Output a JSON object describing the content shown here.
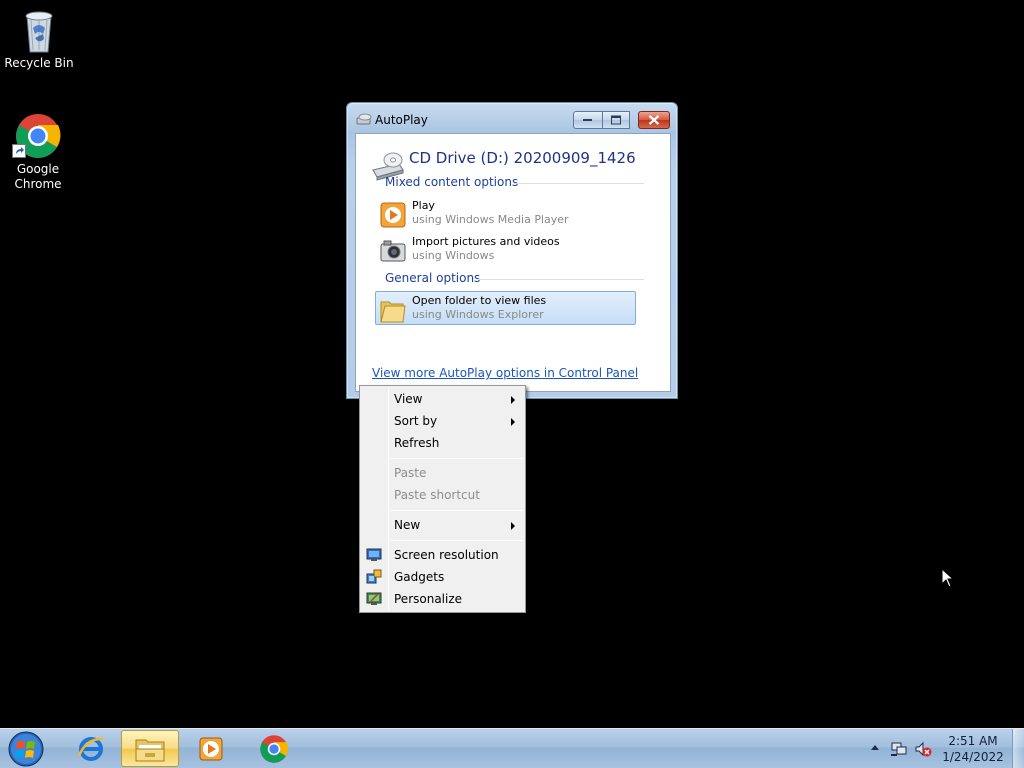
{
  "desktop": {
    "icons": [
      {
        "label": "Recycle Bin",
        "icon": "recycle-bin-icon"
      },
      {
        "label": "Google Chrome",
        "icon": "chrome-icon"
      }
    ]
  },
  "autoplay": {
    "title": "AutoPlay",
    "drive_title": "CD Drive (D:) 20200909_1426",
    "mixed_header": "Mixed content options",
    "options": [
      {
        "main": "Play",
        "sub": "using Windows Media Player",
        "icon": "media-player-icon"
      },
      {
        "main": "Import pictures and videos",
        "sub": "using Windows",
        "icon": "camera-icon"
      }
    ],
    "general_header": "General options",
    "general_options": [
      {
        "main": "Open folder to view files",
        "sub": "using Windows Explorer",
        "icon": "folder-icon",
        "selected": true
      }
    ],
    "control_panel_link": "View more AutoPlay options in Control Panel"
  },
  "context_menu": {
    "items": [
      {
        "label": "View",
        "submenu": true
      },
      {
        "label": "Sort by",
        "submenu": true
      },
      {
        "label": "Refresh"
      },
      {
        "label": "Paste",
        "disabled": true
      },
      {
        "label": "Paste shortcut",
        "disabled": true
      },
      {
        "label": "New",
        "submenu": true
      },
      {
        "label": "Screen resolution",
        "icon": "screen-resolution-icon"
      },
      {
        "label": "Gadgets",
        "icon": "gadgets-icon"
      },
      {
        "label": "Personalize",
        "icon": "personalize-icon"
      }
    ]
  },
  "taskbar": {
    "buttons": [
      {
        "name": "internet-explorer",
        "icon": "internet-explorer-icon"
      },
      {
        "name": "windows-explorer",
        "icon": "folder-icon",
        "active": true
      },
      {
        "name": "windows-media-player",
        "icon": "media-player-icon"
      },
      {
        "name": "google-chrome",
        "icon": "chrome-icon"
      }
    ],
    "clock_time": "2:51 AM",
    "clock_date": "1/24/2022"
  },
  "colors": {
    "desktop_bg": "#000000",
    "link": "#1b55c0",
    "section_header": "#1e3e9c",
    "drive_title": "#1e3287"
  }
}
